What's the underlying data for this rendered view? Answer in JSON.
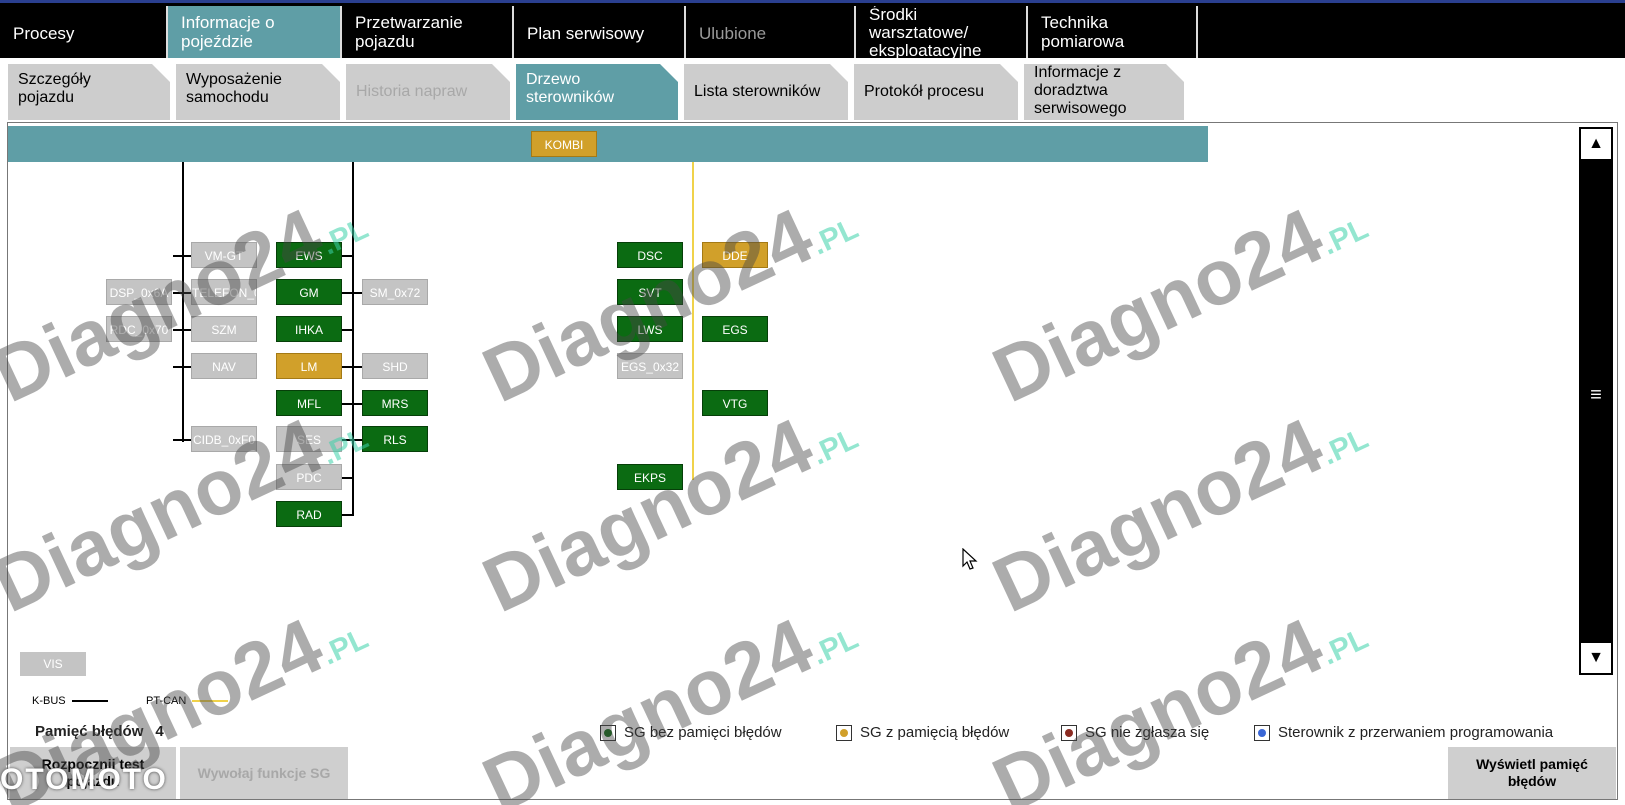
{
  "top_tabs": [
    {
      "label_1": "Procesy",
      "label_2": ""
    },
    {
      "label_1": "Informacje o",
      "label_2": "pojeździe"
    },
    {
      "label_1": "Przetwarzanie",
      "label_2": "pojazdu"
    },
    {
      "label_1": "Plan serwisowy",
      "label_2": ""
    },
    {
      "label_1": "Ulubione",
      "label_2": ""
    },
    {
      "label_1": "Środki",
      "label_2": "warsztatowe/",
      "label_3": "eksploatacyjne"
    },
    {
      "label_1": "Technika",
      "label_2": "pomiarowa"
    }
  ],
  "sub_tabs": [
    {
      "label_1": "Szczegóły",
      "label_2": "pojazdu"
    },
    {
      "label_1": "Wyposażenie",
      "label_2": "samochodu"
    },
    {
      "label_1": "Historia napraw",
      "label_2": ""
    },
    {
      "label_1": "Drzewo",
      "label_2": "sterowników"
    },
    {
      "label_1": "Lista sterowników",
      "label_2": ""
    },
    {
      "label_1": "Protokół procesu",
      "label_2": ""
    },
    {
      "label_1": "Informacje z",
      "label_2": "doradztwa",
      "label_3": "serwisowego"
    }
  ],
  "ecus": {
    "kombi": "KOMBI",
    "vm_gt": "VM-GT",
    "telefon": "TELEFON_0",
    "dsp": "DSP_0x6A",
    "rdc": "RDC_0x70",
    "szm": "SZM",
    "nav": "NAV",
    "cidb": "CIDB_0xF0",
    "ews": "EWS",
    "gm": "GM",
    "ihka": "IHKA",
    "lm": "LM",
    "mfl": "MFL",
    "ses": "SES",
    "pdc": "PDC",
    "rad": "RAD",
    "sm": "SM_0x72",
    "shd": "SHD",
    "mrs": "MRS",
    "rls": "RLS",
    "dsc": "DSC",
    "svt": "SVT",
    "lws": "LWS",
    "egs32": "EGS_0x32",
    "ekps": "EKPS",
    "dde": "DDE",
    "egs": "EGS",
    "vtg": "VTG",
    "vis": "VIS"
  },
  "bus_legend": {
    "kbus": "K-BUS",
    "ptcan": "PT-CAN",
    "kbus_color": "#000000",
    "ptcan_color": "#f0d24a"
  },
  "error_memory": {
    "label": "Pamięć błędów",
    "value": "4"
  },
  "legend": [
    {
      "label": "SG bez pamięci błędów",
      "color": "#0b6b12"
    },
    {
      "label": "SG z pamięcią błędów",
      "color": "#d1a02a"
    },
    {
      "label": "SG nie zgłasza się",
      "color": "#8b2b22"
    },
    {
      "label": "Sterownik z przerwaniem programowania",
      "color": "#3a67d6"
    }
  ],
  "buttons": {
    "start_test_1": "Rozpocznij test",
    "start_test_2": "pojazdu",
    "functions_sg": "Wywołaj funkcje SG",
    "show_errors_1": "Wyświetl pamięć",
    "show_errors_2": "błędów"
  },
  "watermark": "Diagno24",
  "watermark_suffix": ".PL",
  "footer_logo": "OTOMOTO",
  "colors": {
    "accent": "#5f9ea6",
    "ok": "#0b6b12",
    "error": "#d1a02a",
    "inactive": "#c4c4c4"
  }
}
